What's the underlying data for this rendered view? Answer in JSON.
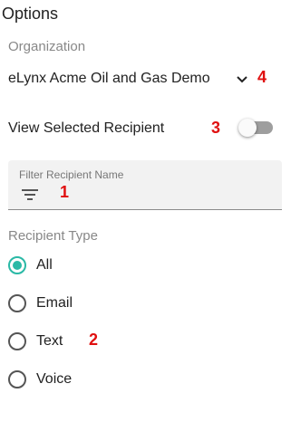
{
  "title": "Options",
  "organization": {
    "label": "Organization",
    "selected": "eLynx Acme Oil and Gas Demo"
  },
  "view_selected": {
    "label": "View Selected Recipient",
    "enabled": false
  },
  "filter": {
    "label": "Filter Recipient Name",
    "value": ""
  },
  "recipient_type": {
    "label": "Recipient Type",
    "options": [
      "All",
      "Email",
      "Text",
      "Voice"
    ],
    "selected": "All"
  },
  "markers": {
    "filter": "1",
    "recipient_type": "2",
    "toggle": "3",
    "organization": "4"
  },
  "colors": {
    "accent": "#2ab9a6",
    "marker": "#e01010",
    "toggle_track": "#9e9e9e",
    "filter_bg": "#f2f2f2"
  },
  "icons": {
    "dropdown": "chevron-down-icon",
    "filter": "filter-icon"
  }
}
